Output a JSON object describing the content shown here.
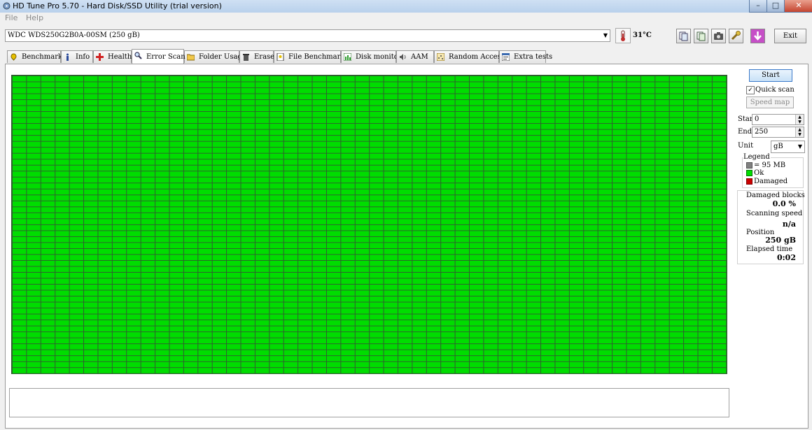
{
  "window": {
    "title": "HD Tune Pro 5.70 - Hard Disk/SSD Utility (trial version)",
    "minimize": "–",
    "maximize": "□",
    "close": "✕"
  },
  "menu": {
    "file": "File",
    "help": "Help"
  },
  "drive": {
    "selected": "WDC WDS250G2B0A-00SM (250 gB)",
    "temperature": "31°C"
  },
  "toolbar": {
    "exit": "Exit"
  },
  "tabs": [
    {
      "label": "Benchmark",
      "icon": "benchmark-icon"
    },
    {
      "label": "Info",
      "icon": "info-icon"
    },
    {
      "label": "Health",
      "icon": "health-icon"
    },
    {
      "label": "Error Scan",
      "icon": "magnifier-icon"
    },
    {
      "label": "Folder Usage",
      "icon": "folder-icon"
    },
    {
      "label": "Erase",
      "icon": "trash-icon"
    },
    {
      "label": "File Benchmark",
      "icon": "file-benchmark-icon"
    },
    {
      "label": "Disk monitor",
      "icon": "disk-monitor-icon"
    },
    {
      "label": "AAM",
      "icon": "speaker-icon"
    },
    {
      "label": "Random Access",
      "icon": "random-access-icon"
    },
    {
      "label": "Extra tests",
      "icon": "extra-tests-icon"
    }
  ],
  "active_tab": "Error Scan",
  "controls": {
    "start": "Start",
    "quick_scan": "Quick scan",
    "quick_scan_checked": true,
    "speed_map": "Speed map",
    "start_label": "Start",
    "start_value": "0",
    "end_label": "End",
    "end_value": "250",
    "unit_label": "Unit",
    "unit_value": "gB"
  },
  "legend": {
    "title": "Legend",
    "block_size": "= 95 MB",
    "ok": "Ok",
    "damaged": "Damaged"
  },
  "colors": {
    "ok": "#00dd00",
    "damaged": "#cc0000",
    "block": "#808080",
    "grid_line": "#2f5f2f"
  },
  "stats": {
    "damaged_blocks_label": "Damaged blocks",
    "damaged_blocks_value": "0.0 %",
    "scanning_speed_label": "Scanning speed",
    "scanning_speed_value": "n/a",
    "position_label": "Position",
    "position_value": "250 gB",
    "elapsed_time_label": "Elapsed time",
    "elapsed_time_value": "0:02"
  }
}
